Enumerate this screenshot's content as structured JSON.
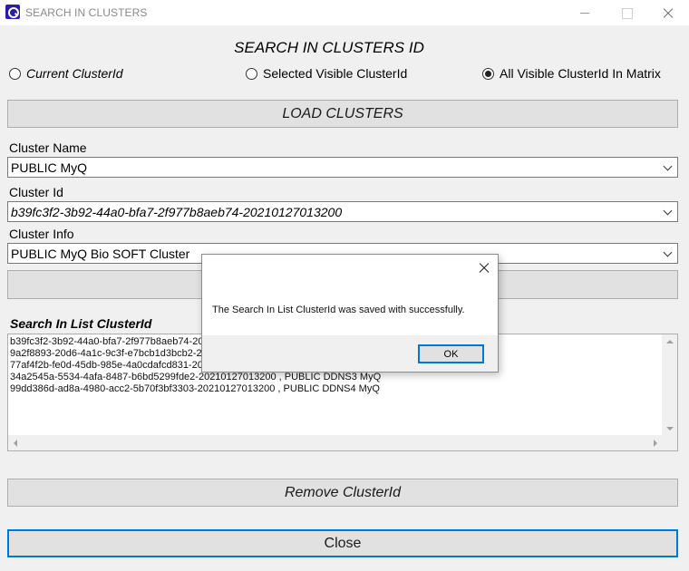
{
  "window": {
    "title": "SEARCH IN CLUSTERS"
  },
  "heading": "SEARCH IN CLUSTERS ID",
  "radios": {
    "current": {
      "label": "Current ClusterId",
      "checked": false
    },
    "selected": {
      "label": "Selected Visible ClusterId",
      "checked": false
    },
    "all": {
      "label": "All Visible ClusterId In Matrix",
      "checked": true
    }
  },
  "buttons": {
    "load_clusters": "LOAD CLUSTERS",
    "blank": "",
    "remove_clusterid": "Remove ClusterId",
    "close": "Close"
  },
  "fields": {
    "cluster_name": {
      "label": "Cluster Name",
      "value": "PUBLIC MyQ"
    },
    "cluster_id": {
      "label": "Cluster Id",
      "value": "b39fc3f2-3b92-44a0-bfa7-2f977b8aeb74-20210127013200"
    },
    "cluster_info": {
      "label": "Cluster Info",
      "value": "PUBLIC MyQ Bio SOFT Cluster"
    }
  },
  "search_list": {
    "label": "Search In List ClusterId",
    "items": [
      "b39fc3f2-3b92-44a0-bfa7-2f977b8aeb74-202",
      "9a2f8893-20d6-4a1c-9c3f-e7bcb1d3bcb2-20",
      "77af4f2b-fe0d-45db-985e-4a0cdafcd831-202",
      "34a2545a-5534-4afa-8487-b6bd5299fde2-20210127013200 , PUBLIC DDNS3 MyQ",
      "99dd386d-ad8a-4980-acc2-5b70f3bf3303-20210127013200 , PUBLIC DDNS4 MyQ"
    ]
  },
  "dialog": {
    "message": "The Search In List ClusterId was saved with successfully.",
    "ok_label": "OK"
  },
  "colors": {
    "accent": "#0078d7",
    "app_icon": "#2a1ea8",
    "background": "#f0f0f0"
  }
}
